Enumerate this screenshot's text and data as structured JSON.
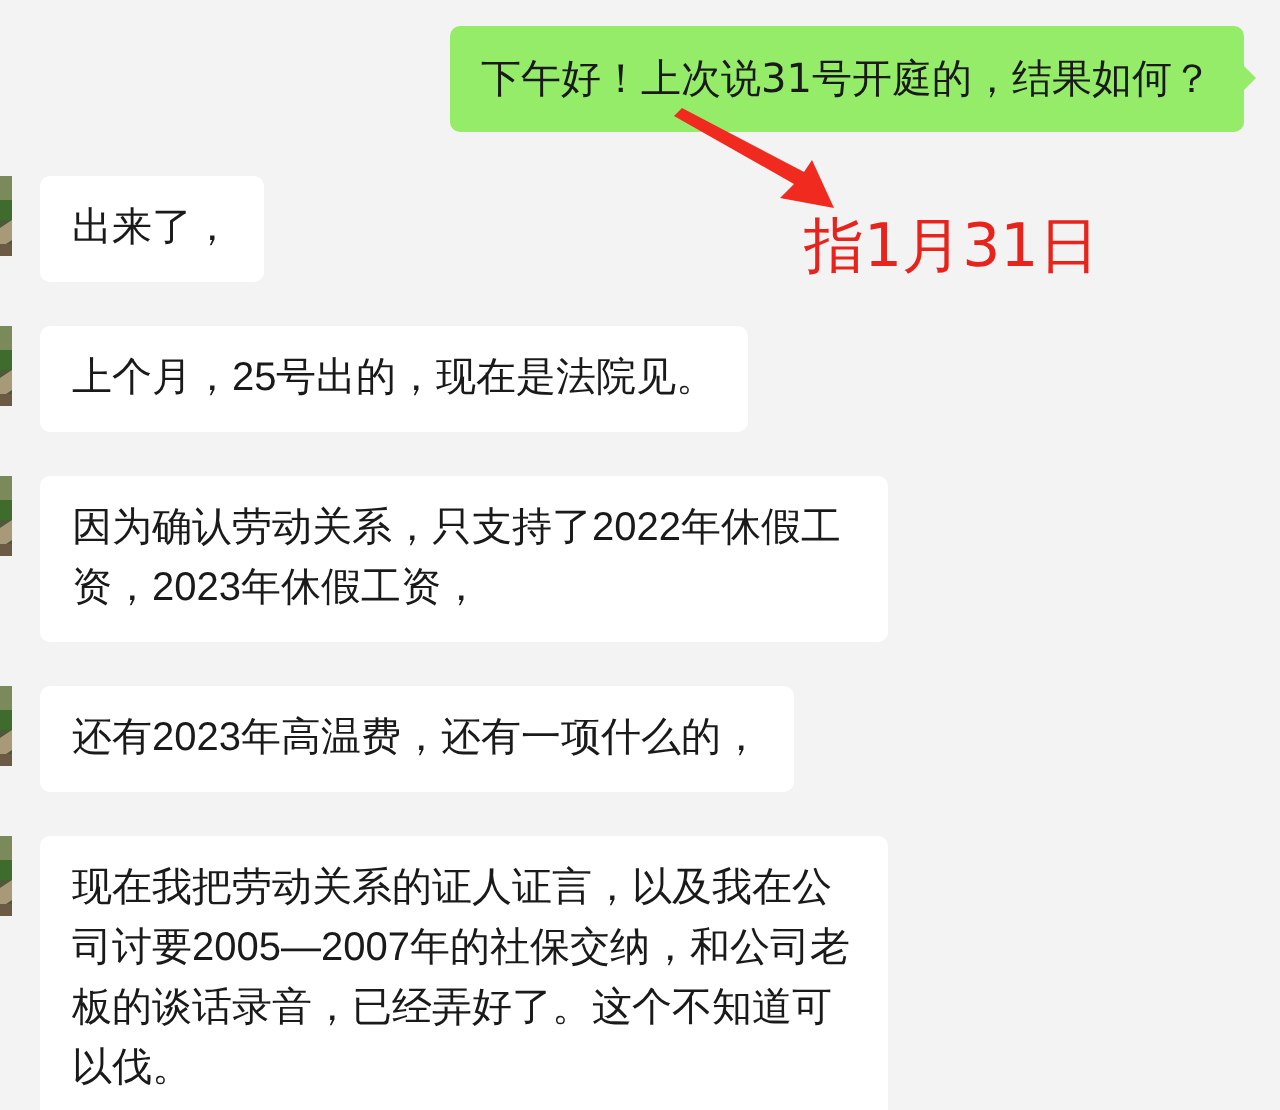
{
  "sent_message": {
    "text": "下午好！上次说31号开庭的，结果如何？"
  },
  "annotation": {
    "text": "指1月31日"
  },
  "received_messages": [
    {
      "text": "出来了，"
    },
    {
      "text": "上个月，25号出的，现在是法院见。"
    },
    {
      "text": "因为确认劳动关系，只支持了2022年休假工资，2023年休假工资，"
    },
    {
      "text": "还有2023年高温费，还有一项什么的，"
    },
    {
      "text": "现在我把劳动关系的证人证言，以及我在公司讨要2005—2007年的社保交纳，和公司老板的谈话录音，已经弄好了。这个不知道可以伐。"
    }
  ]
}
